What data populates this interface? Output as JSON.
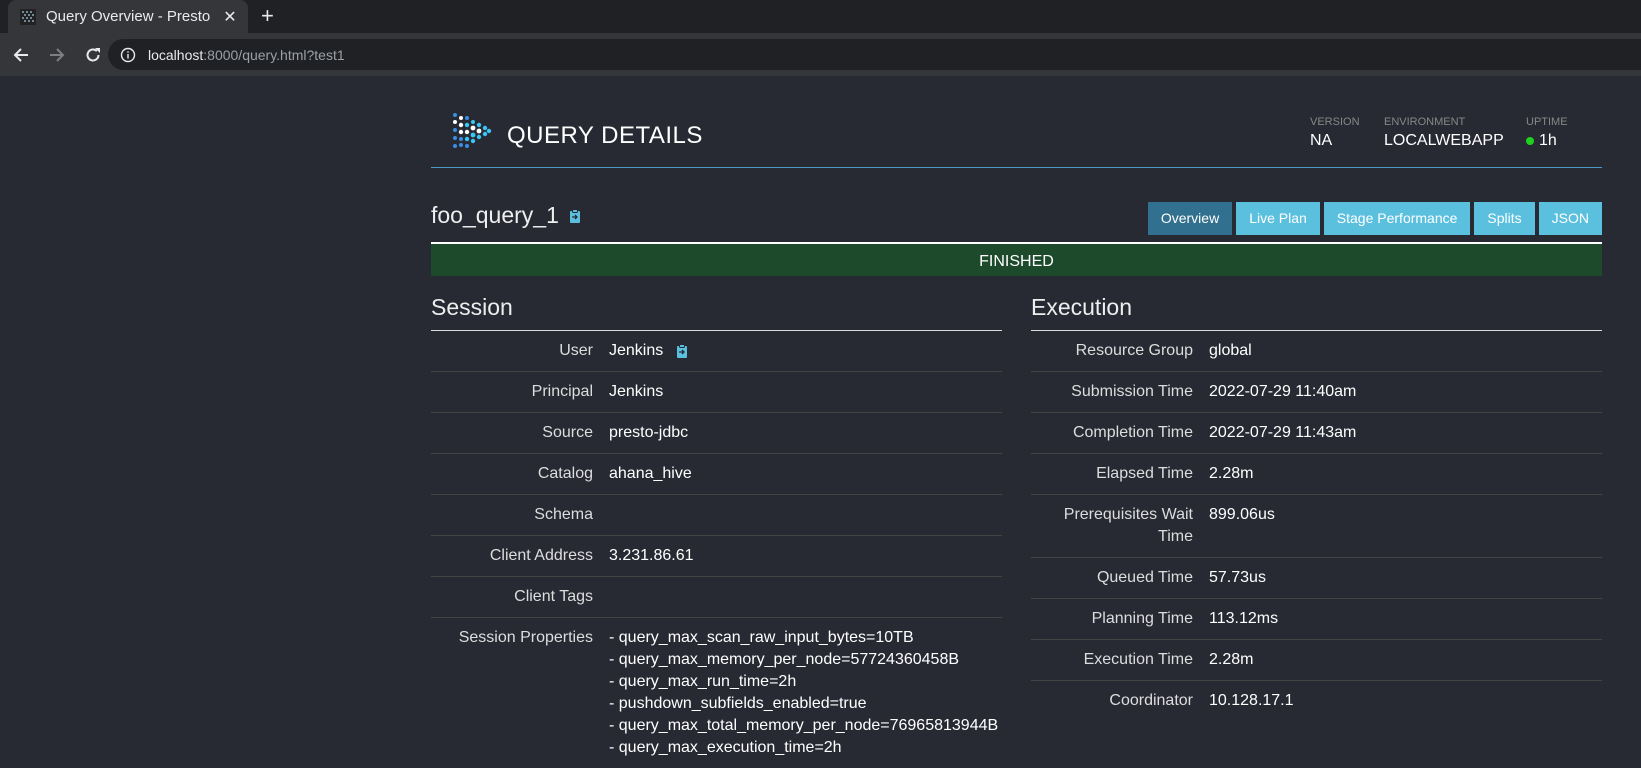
{
  "browser": {
    "tab_title": "Query Overview - Presto",
    "tab_close": "✕",
    "new_tab": "+",
    "url_host": "localhost",
    "url_rest": ":8000/query.html?test1"
  },
  "header": {
    "title": "QUERY DETAILS",
    "version_label": "VERSION",
    "version_value": "NA",
    "environment_label": "ENVIRONMENT",
    "environment_value": "LOCALWEBAPP",
    "uptime_label": "UPTIME",
    "uptime_value": "1h",
    "uptime_status_color": "#1fd01f"
  },
  "query": {
    "id": "foo_query_1",
    "state": "FINISHED"
  },
  "tabs": [
    "Overview",
    "Live Plan",
    "Stage Performance",
    "Splits",
    "JSON"
  ],
  "active_tab": "Overview",
  "session": {
    "title": "Session",
    "rows": [
      {
        "key": "User",
        "value": "Jenkins"
      },
      {
        "key": "Principal",
        "value": "Jenkins"
      },
      {
        "key": "Source",
        "value": "presto-jdbc"
      },
      {
        "key": "Catalog",
        "value": "ahana_hive"
      },
      {
        "key": "Schema",
        "value": ""
      },
      {
        "key": "Client Address",
        "value": "3.231.86.61"
      },
      {
        "key": "Client Tags",
        "value": ""
      }
    ],
    "properties_label": "Session Properties",
    "properties": [
      "- query_max_scan_raw_input_bytes=10TB",
      "- query_max_memory_per_node=57724360458B",
      "- query_max_run_time=2h",
      "- pushdown_subfields_enabled=true",
      "- query_max_total_memory_per_node=76965813944B",
      "- query_max_execution_time=2h"
    ]
  },
  "execution": {
    "title": "Execution",
    "rows": [
      {
        "key": "Resource Group",
        "value": "global"
      },
      {
        "key": "Submission Time",
        "value": "2022-07-29 11:40am"
      },
      {
        "key": "Completion Time",
        "value": "2022-07-29 11:43am"
      },
      {
        "key": "Elapsed Time",
        "value": "2.28m"
      },
      {
        "key": "Prerequisites Wait Time",
        "value": "899.06us"
      },
      {
        "key": "Queued Time",
        "value": "57.73us"
      },
      {
        "key": "Planning Time",
        "value": "113.12ms"
      },
      {
        "key": "Execution Time",
        "value": "2.28m"
      },
      {
        "key": "Coordinator",
        "value": "10.128.17.1"
      }
    ]
  }
}
